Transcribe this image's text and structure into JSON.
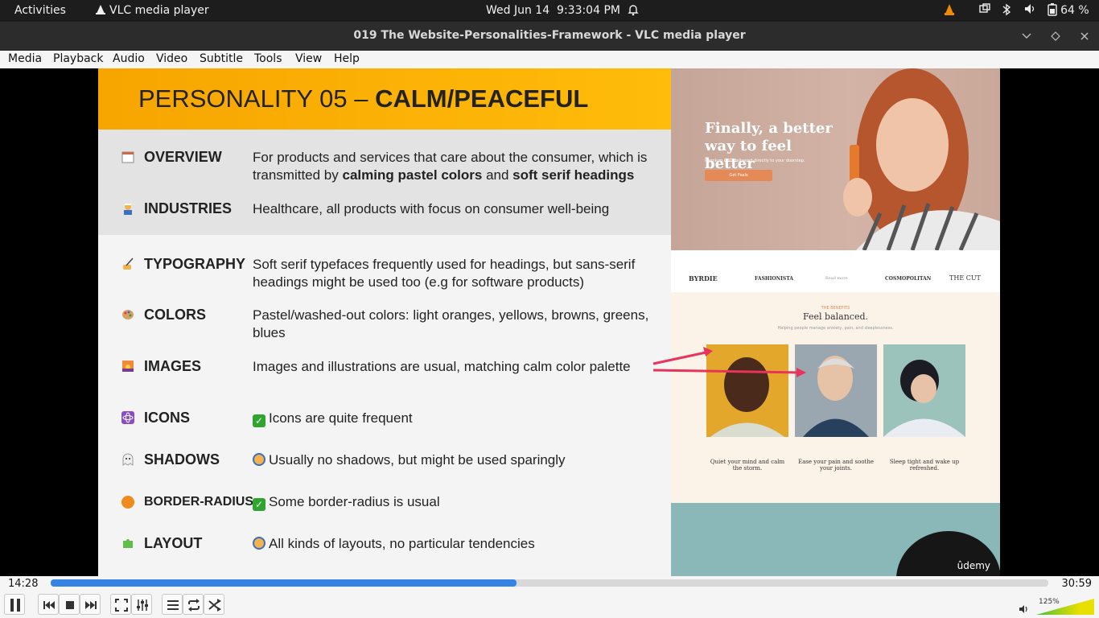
{
  "topbar": {
    "activities": "Activities",
    "app_name": "VLC media player",
    "date": "Wed Jun 14",
    "time": "9:33:04 PM",
    "battery": "64 %"
  },
  "window": {
    "title": "019 The Website-Personalities-Framework - VLC media player"
  },
  "menu": [
    "Media",
    "Playback",
    "Audio",
    "Video",
    "Subtitle",
    "Tools",
    "View",
    "Help"
  ],
  "slide": {
    "title_prefix": "PERSONALITY 05 – ",
    "title_bold": "CALM/PEACEFUL",
    "rows": [
      {
        "label": "OVERVIEW",
        "desc_1": "For products and services that care about the consumer, which is transmitted by ",
        "desc_b1": "calming pastel colors",
        "desc_2": " and ",
        "desc_b2": "soft serif headings"
      },
      {
        "label": "INDUSTRIES",
        "desc": "Healthcare, all products with focus on consumer well-being"
      },
      {
        "label": "TYPOGRAPHY",
        "desc": "Soft serif typefaces frequently used for headings, but sans-serif headings might be used too (e.g for software products)"
      },
      {
        "label": "COLORS",
        "desc": "Pastel/washed-out colors: light oranges, yellows, browns, greens, blues"
      },
      {
        "label": "IMAGES",
        "desc": "Images and illustrations are usual, matching calm color palette"
      },
      {
        "label": "ICONS",
        "desc": "Icons are quite frequent"
      },
      {
        "label": "SHADOWS",
        "desc": "Usually no shadows, but might be used sparingly"
      },
      {
        "label": "BORDER-RADIUS",
        "desc": "Some border-radius is usual"
      },
      {
        "label": "LAYOUT",
        "desc": "All kinds of layouts, no particular tendencies"
      }
    ],
    "site": {
      "hero_title": "Finally, a better way to feel better",
      "hero_sub": "Premium CBD delivered directly to your doorstep.",
      "hero_button": "Get Feals",
      "logos": [
        "BYRDIE",
        "FASHIONISTA",
        "Read more",
        "COSMOPOLITAN",
        "THE CUT"
      ],
      "benefits_kicker": "THE BENEFITS",
      "benefits_title": "Feel balanced.",
      "benefits_sub": "Helping people manage anxiety, pain, and sleeplessness.",
      "captions": [
        "Quiet your mind and calm the storm.",
        "Ease your pain and soothe your joints.",
        "Sleep tight and wake up refreshed."
      ],
      "watermark": "ûdemy"
    }
  },
  "playback": {
    "current_time": "14:28",
    "total_time": "30:59",
    "progress_fraction": 0.4669,
    "volume_label": "125%"
  },
  "colors": {
    "accent_blue": "#3584e4",
    "slide_header": "#ffb000"
  }
}
